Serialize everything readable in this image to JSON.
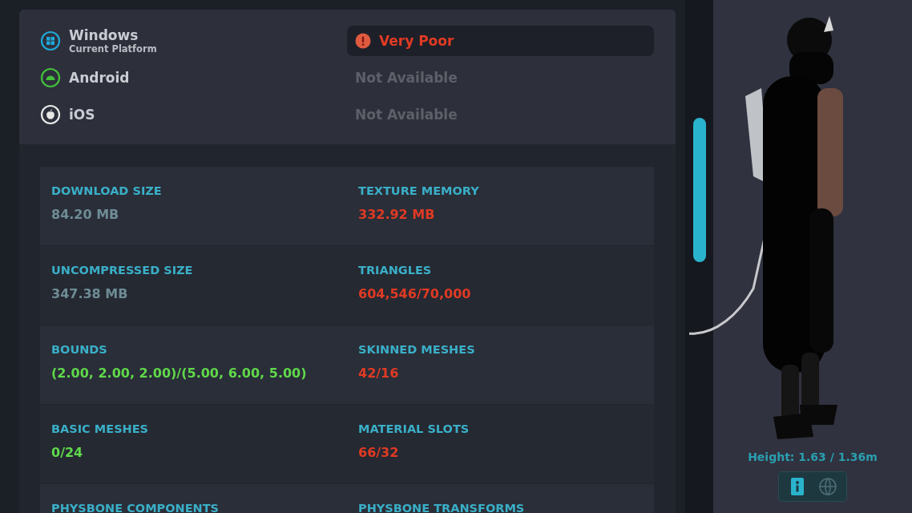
{
  "platforms": [
    {
      "name": "Windows",
      "subtitle": "Current Platform",
      "kind": "windows",
      "status": {
        "text": "Very Poor",
        "kind": "very_poor"
      }
    },
    {
      "name": "Android",
      "kind": "android",
      "status": {
        "text": "Not Available",
        "kind": "unavailable"
      }
    },
    {
      "name": "iOS",
      "kind": "apple",
      "status": {
        "text": "Not Available",
        "kind": "unavailable"
      }
    }
  ],
  "stats": [
    {
      "label": "DOWNLOAD SIZE",
      "value": "84.20 MB",
      "color": "#6e8c95"
    },
    {
      "label": "TEXTURE MEMORY",
      "value": "332.92 MB",
      "color": "#e03a24"
    },
    {
      "label": "UNCOMPRESSED SIZE",
      "value": "347.38 MB",
      "color": "#6e8c95"
    },
    {
      "label": "TRIANGLES",
      "value": "604,546/70,000",
      "color": "#e03a24"
    },
    {
      "label": "BOUNDS",
      "value": "(2.00, 2.00, 2.00)/(5.00, 6.00, 5.00)",
      "color": "#5fd94a"
    },
    {
      "label": "SKINNED MESHES",
      "value": "42/16",
      "color": "#e03a24"
    },
    {
      "label": "BASIC MESHES",
      "value": "0/24",
      "color": "#5fd94a"
    },
    {
      "label": "MATERIAL SLOTS",
      "value": "66/32",
      "color": "#e03a24"
    },
    {
      "label": "PHYSBONE COMPONENTS"
    },
    {
      "label": "PHYSBONE TRANSFORMS"
    }
  ],
  "preview": {
    "kind": "picture",
    "height": "Height: 1.63 / 1.36m",
    "tools": [
      {
        "kind": "info",
        "selected": true
      },
      {
        "kind": "globe",
        "selected": false
      }
    ]
  }
}
